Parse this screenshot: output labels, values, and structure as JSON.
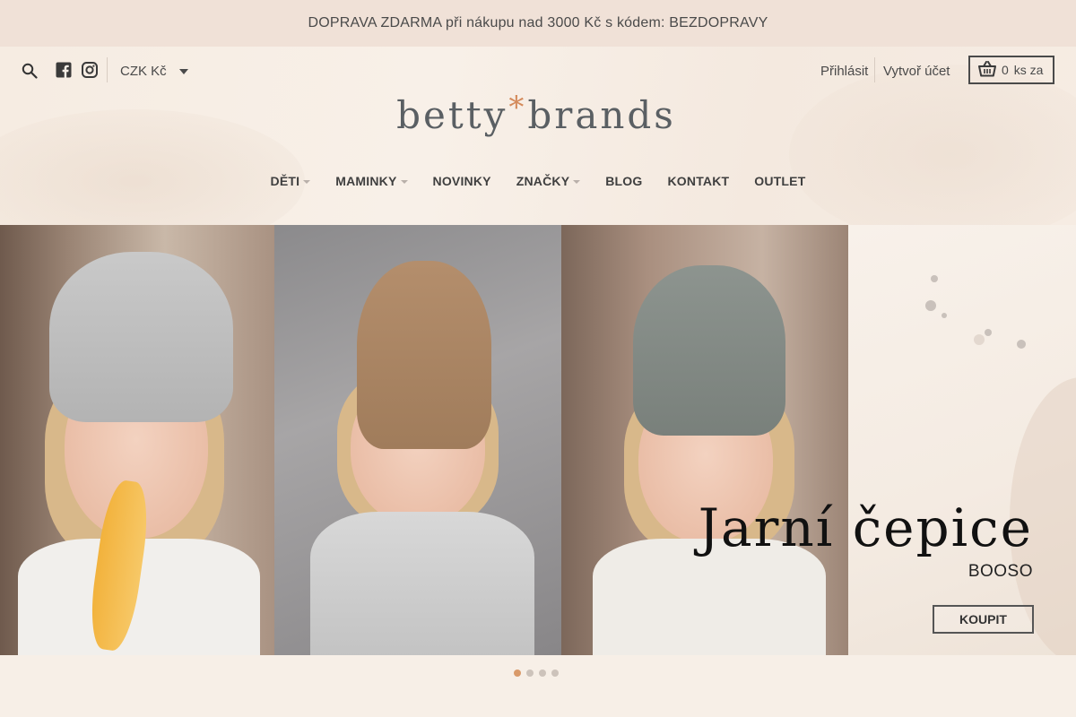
{
  "announcement": {
    "text": "DOPRAVA ZDARMA při nákupu nad 3000 Kč s kódem: BEZDOPRAVY"
  },
  "topbar": {
    "search_icon": "search-icon",
    "social": [
      "facebook-icon",
      "instagram-icon"
    ],
    "currency": "CZK Kč",
    "login": "Přihlásit",
    "register": "Vytvoř účet",
    "cart": {
      "count": "0",
      "label": "ks za"
    }
  },
  "logo": {
    "part1": "betty",
    "star": "*",
    "part2": "brands"
  },
  "nav": {
    "items": [
      {
        "label": "DĚTI",
        "dropdown": true
      },
      {
        "label": "MAMINKY",
        "dropdown": true
      },
      {
        "label": "NOVINKY",
        "dropdown": false
      },
      {
        "label": "ZNAČKY",
        "dropdown": true
      },
      {
        "label": "BLOG",
        "dropdown": false
      },
      {
        "label": "KONTAKT",
        "dropdown": false
      },
      {
        "label": "OUTLET",
        "dropdown": false
      }
    ]
  },
  "slide": {
    "title": "Jarní čepice",
    "subtitle": "BOOSO",
    "button": "KOUPIT"
  },
  "slider": {
    "count": 4,
    "active": 1
  },
  "colors": {
    "accent": "#d48a5b",
    "background": "#f7efe7",
    "announcement_bg": "#f0e1d7",
    "text": "#4a4a4a"
  }
}
